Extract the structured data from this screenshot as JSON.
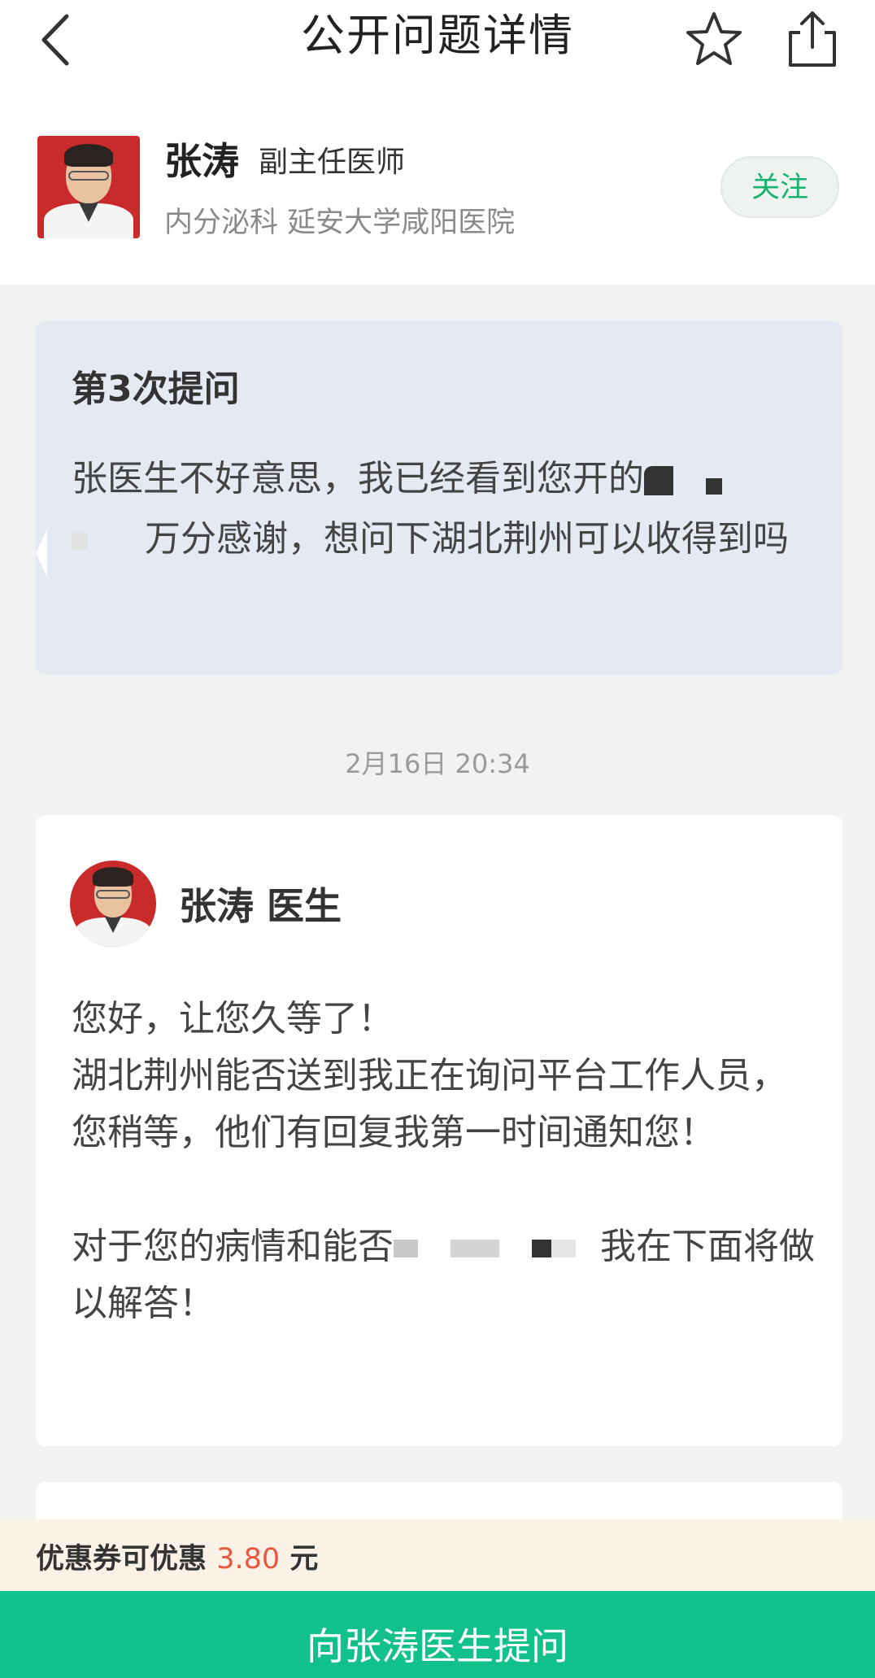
{
  "nav": {
    "title": "公开问题详情",
    "back_icon": "chevron-left-icon",
    "star_icon": "star-outline-icon",
    "share_icon": "share-icon"
  },
  "doctor": {
    "name": "张涛",
    "title": "副主任医师",
    "department": "内分泌科 延安大学咸阳医院",
    "follow_label": "关注"
  },
  "question": {
    "label": "第3次提问",
    "text_part1": "张医生不好意思，我已经看到您开的",
    "text_part2": "万分感谢，想问下湖北荆州可以收得到吗"
  },
  "timestamp": "2月16日 20:34",
  "answer": {
    "name": "张涛 医生",
    "line1": "您好，让您久等了！",
    "line2": "湖北荆州能否送到我正在询问平台工作人员，您稍等，他们有回复我第一时间通知您！",
    "line3_part1": "对于您的病情和能否",
    "line3_part2": "我在下面将做以解答！"
  },
  "coupon": {
    "prefix": "优惠券可优惠",
    "amount": "3.80",
    "suffix": "元"
  },
  "ask_button_label": "向张涛医生提问",
  "colors": {
    "accent_green": "#12c08a",
    "follow_text": "#17b36f",
    "coupon_amount": "#e9573f",
    "question_bg": "#e5eaf2"
  }
}
